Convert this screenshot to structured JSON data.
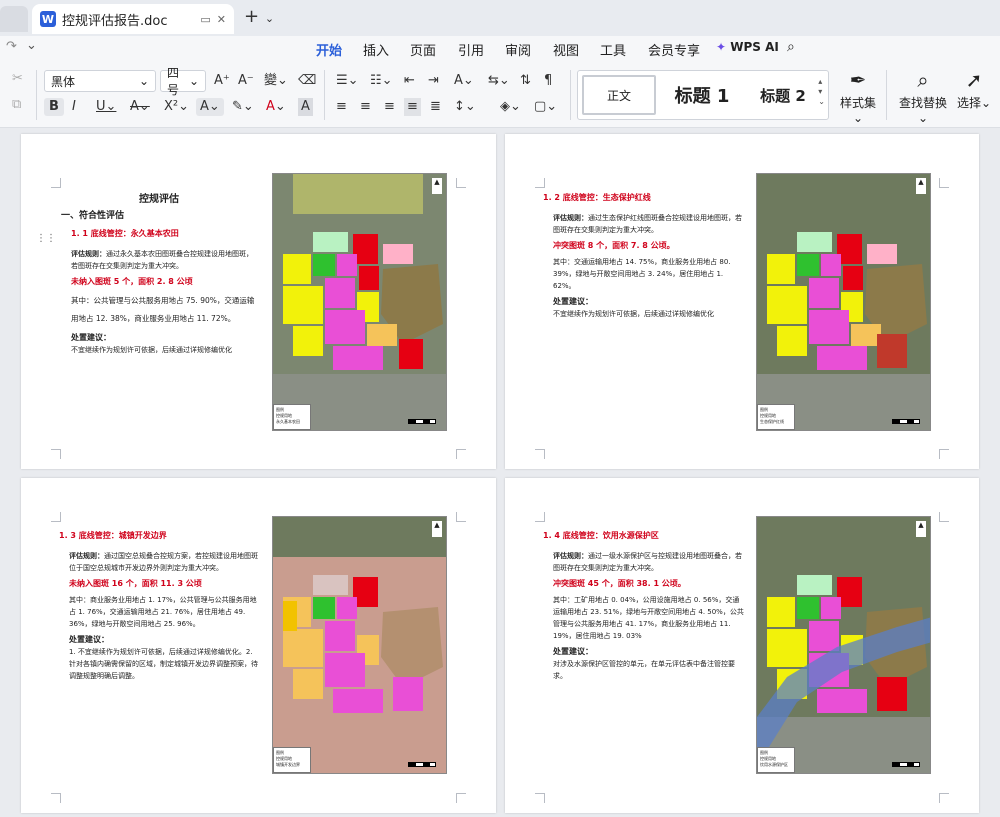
{
  "window": {
    "doc_tab_title": "控规评估报告.doc",
    "doc_icon_letter": "W"
  },
  "menu": [
    "开始",
    "插入",
    "页面",
    "引用",
    "审阅",
    "视图",
    "工具",
    "会员专享"
  ],
  "menu_active": "开始",
  "wps_ai": "WPS AI",
  "toolbar": {
    "font_name": "黑体",
    "font_size": "四号",
    "style_normal": "正文",
    "style_h1": "标题 1",
    "style_h2": "标题 2",
    "styles_label": "样式集",
    "find_replace": "查找替换",
    "select": "选择"
  },
  "pages": [
    {
      "doc_title": "控规评估",
      "section": "一、符合性评估",
      "subtitle": "1. 1 底线管控：永久基本农田",
      "rule_label": "评估规则：",
      "rule_text": "通过永久基本农田图斑叠合控规建设用地图斑，若图斑存在交集则判定为重大冲突。",
      "conflict": "未纳入图斑 5 个，面积 2. 8 公顷",
      "detail": "其中：公共管理与公共服务用地占 75. 90%，交通运输用地占 12. 38%，商业服务业用地占 11. 72%。",
      "advice_label": "处置建议：",
      "advice": "不宜继续作为规划许可依据，后续通过详规修编优化"
    },
    {
      "subtitle": "1. 2 底线管控：生态保护红线",
      "rule_label": "评估规则：",
      "rule_text": "通过生态保护红线图斑叠合控规建设用地图斑，若图斑存在交集则判定为重大冲突。",
      "conflict": "冲突图斑 8 个，面积 7. 8 公顷。",
      "detail": "其中：交通运输用地占 14. 75%，商业服务业用地占 80. 39%，绿地与开敞空间用地占 3. 24%，居住用地占 1. 62%。",
      "advice_label": "处置建议：",
      "advice": "不宜继续作为规划许可依据，后续通过详规修编优化"
    },
    {
      "subtitle": "1. 3 底线管控：城镇开发边界",
      "rule_label": "评估规则：",
      "rule_text": "通过国空总规叠合控规方案，若控规建设用地图斑位于国空总规城市开发边界外则判定为重大冲突。",
      "conflict": "未纳入图斑 16 个，面积 11. 3 公顷",
      "detail": "其中：商业服务业用地占 1. 17%，公共管理与公共服务用地占 1. 76%，交通运输用地占 21. 76%，居住用地占 49. 36%，绿地与开敞空间用地占 25. 96%。",
      "advice_label": "处置建议：",
      "advice": "1. 不宜继续作为规划许可依据，后续通过详规修编优化。2. 针对各镇内确需保留的区域，制定城镇开发边界调整预案，待调整规整明确后调整。"
    },
    {
      "subtitle": "1. 4 底线管控：饮用水源保护区",
      "rule_label": "评估规则：",
      "rule_text": "通过一级水源保护区与控规建设用地图斑叠合，若图斑存在交集则判定为重大冲突。",
      "conflict": "冲突图斑 45 个，面积 38. 1 公顷。",
      "detail": "其中：工矿用地占 0. 04%，公用设施用地占 0. 56%，交通运输用地占 23. 51%，绿地与开敞空间用地占 4. 50%，公共管理与公共服务用地占 41. 17%，商业服务业用地占 11. 19%，居住用地占 19. 03%",
      "advice_label": "处置建议：",
      "advice": "对涉及水源保护区管控的单元，在单元评估表中备注管控要求。"
    }
  ],
  "map_legend": [
    {
      "title": "图例",
      "a": "控规用地",
      "b": "永久基本农田"
    },
    {
      "title": "图例",
      "a": "控规用地",
      "b": "生态保护红线"
    },
    {
      "title": "图例",
      "a": "控规用地",
      "b": "城镇开发边界"
    },
    {
      "title": "图例",
      "a": "控规用地",
      "b": "饮用水源保护区"
    }
  ],
  "colors": {
    "accent": "#2b5fd9",
    "heading_red": "#d0021b",
    "magenta": "#e94fd6",
    "yellow": "#f2f20a",
    "red": "#e60012"
  }
}
